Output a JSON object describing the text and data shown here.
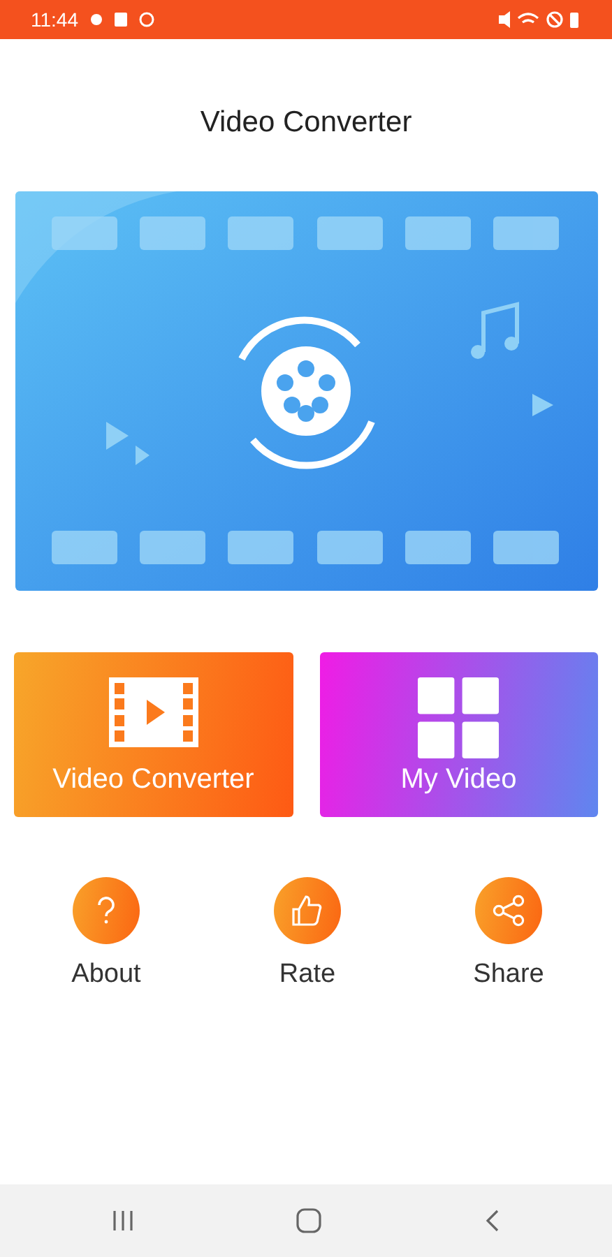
{
  "status_bar": {
    "time": "11:44"
  },
  "title": "Video Converter",
  "tiles": [
    {
      "label": "Video Converter",
      "kind": "convert"
    },
    {
      "label": "My Video",
      "kind": "gallery"
    }
  ],
  "actions": [
    {
      "label": "About",
      "kind": "about"
    },
    {
      "label": "Rate",
      "kind": "rate"
    },
    {
      "label": "Share",
      "kind": "share"
    }
  ]
}
